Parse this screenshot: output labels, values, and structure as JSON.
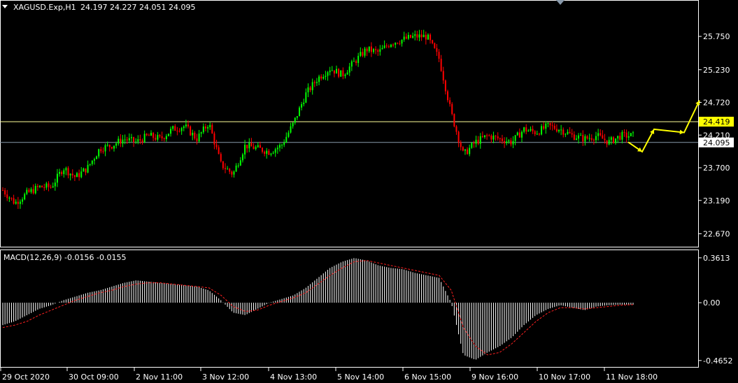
{
  "header": {
    "symbol": "XAGUSD.Exp,H1",
    "ohlc": "24.197 24.227 24.051 24.095"
  },
  "colors": {
    "background": "#000000",
    "bull": "#00ff00",
    "bear": "#ff0000",
    "level_line": "#ffff99",
    "bid_line": "#8899aa",
    "arrow": "#ffff00",
    "macd_hist": "#ffffff",
    "macd_signal": "#ff0000",
    "grid_frame": "#ffffff"
  },
  "chart_data": [
    {
      "type": "candlestick",
      "title": "XAGUSD.Exp,H1",
      "y_ticks": [
        "25.750",
        "25.230",
        "24.720",
        "24.210",
        "23.700",
        "23.190",
        "22.670"
      ],
      "ylim": [
        22.5,
        26.1
      ],
      "x_ticks": [
        "29 Oct 2020",
        "30 Oct 09:00",
        "2 Nov 11:00",
        "3 Nov 12:00",
        "4 Nov 13:00",
        "5 Nov 14:00",
        "6 Nov 15:00",
        "9 Nov 16:00",
        "10 Nov 17:00",
        "11 Nov 18:00"
      ],
      "level_line": 24.419,
      "level_label": "24.419",
      "bid_line": 24.095,
      "bid_label": "24.095",
      "close_path": [
        [
          0,
          23.35
        ],
        [
          1,
          23.15
        ],
        [
          2,
          23.3
        ],
        [
          3,
          23.4
        ],
        [
          4,
          23.4
        ],
        [
          5,
          23.7
        ],
        [
          6,
          23.55
        ],
        [
          7,
          23.7
        ],
        [
          8,
          24.0
        ],
        [
          9,
          24.05
        ],
        [
          10,
          24.15
        ],
        [
          11,
          24.1
        ],
        [
          12,
          24.2
        ],
        [
          13,
          24.15
        ],
        [
          14,
          24.3
        ],
        [
          15,
          24.35
        ],
        [
          16,
          24.15
        ],
        [
          17,
          24.4
        ],
        [
          18,
          23.75
        ],
        [
          19,
          23.6
        ],
        [
          20,
          24.05
        ],
        [
          21,
          24.0
        ],
        [
          22,
          23.95
        ],
        [
          23,
          24.05
        ],
        [
          24,
          24.4
        ],
        [
          25,
          24.85
        ],
        [
          26,
          25.1
        ],
        [
          27,
          25.25
        ],
        [
          28,
          25.15
        ],
        [
          29,
          25.35
        ],
        [
          30,
          25.55
        ],
        [
          31,
          25.5
        ],
        [
          32,
          25.65
        ],
        [
          33,
          25.7
        ],
        [
          34,
          25.75
        ],
        [
          35,
          25.75
        ],
        [
          36,
          25.4
        ],
        [
          37,
          24.55
        ],
        [
          38,
          23.9
        ],
        [
          39,
          24.1
        ],
        [
          40,
          24.2
        ],
        [
          41,
          24.15
        ],
        [
          42,
          24.1
        ],
        [
          43,
          24.3
        ],
        [
          44,
          24.25
        ],
        [
          45,
          24.35
        ],
        [
          46,
          24.3
        ],
        [
          47,
          24.2
        ],
        [
          48,
          24.15
        ],
        [
          49,
          24.2
        ],
        [
          50,
          24.1
        ],
        [
          51,
          24.2
        ],
        [
          52,
          24.2
        ]
      ],
      "n_positions": 53,
      "projection": [
        24.1,
        23.95,
        24.3,
        24.25,
        24.75
      ]
    },
    {
      "type": "histogram+line",
      "title": "MACD(12,26,9) -0.0156 -0.0155",
      "y_ticks": [
        "0.3613",
        "0.00",
        "-0.4652"
      ],
      "ylim": [
        -0.5,
        0.4
      ],
      "histogram": [
        -0.18,
        -0.15,
        -0.1,
        -0.05,
        -0.02,
        0.02,
        0.05,
        0.08,
        0.1,
        0.13,
        0.16,
        0.18,
        0.17,
        0.16,
        0.15,
        0.14,
        0.13,
        0.1,
        0.02,
        -0.08,
        -0.1,
        -0.05,
        0.0,
        0.03,
        0.06,
        0.12,
        0.2,
        0.28,
        0.33,
        0.36,
        0.34,
        0.3,
        0.28,
        0.27,
        0.24,
        0.22,
        0.2,
        0.0,
        -0.42,
        -0.46,
        -0.4,
        -0.35,
        -0.28,
        -0.18,
        -0.1,
        -0.05,
        -0.02,
        -0.04,
        -0.06,
        -0.03,
        -0.02,
        -0.015,
        -0.016
      ],
      "signal": [
        -0.2,
        -0.18,
        -0.15,
        -0.1,
        -0.06,
        -0.02,
        0.02,
        0.05,
        0.08,
        0.1,
        0.13,
        0.15,
        0.16,
        0.16,
        0.15,
        0.14,
        0.13,
        0.12,
        0.06,
        -0.03,
        -0.07,
        -0.06,
        -0.02,
        0.01,
        0.04,
        0.08,
        0.15,
        0.22,
        0.28,
        0.33,
        0.34,
        0.32,
        0.3,
        0.28,
        0.26,
        0.24,
        0.22,
        0.1,
        -0.2,
        -0.35,
        -0.42,
        -0.4,
        -0.33,
        -0.24,
        -0.15,
        -0.08,
        -0.04,
        -0.04,
        -0.05,
        -0.04,
        -0.03,
        -0.02,
        -0.0155
      ]
    }
  ]
}
